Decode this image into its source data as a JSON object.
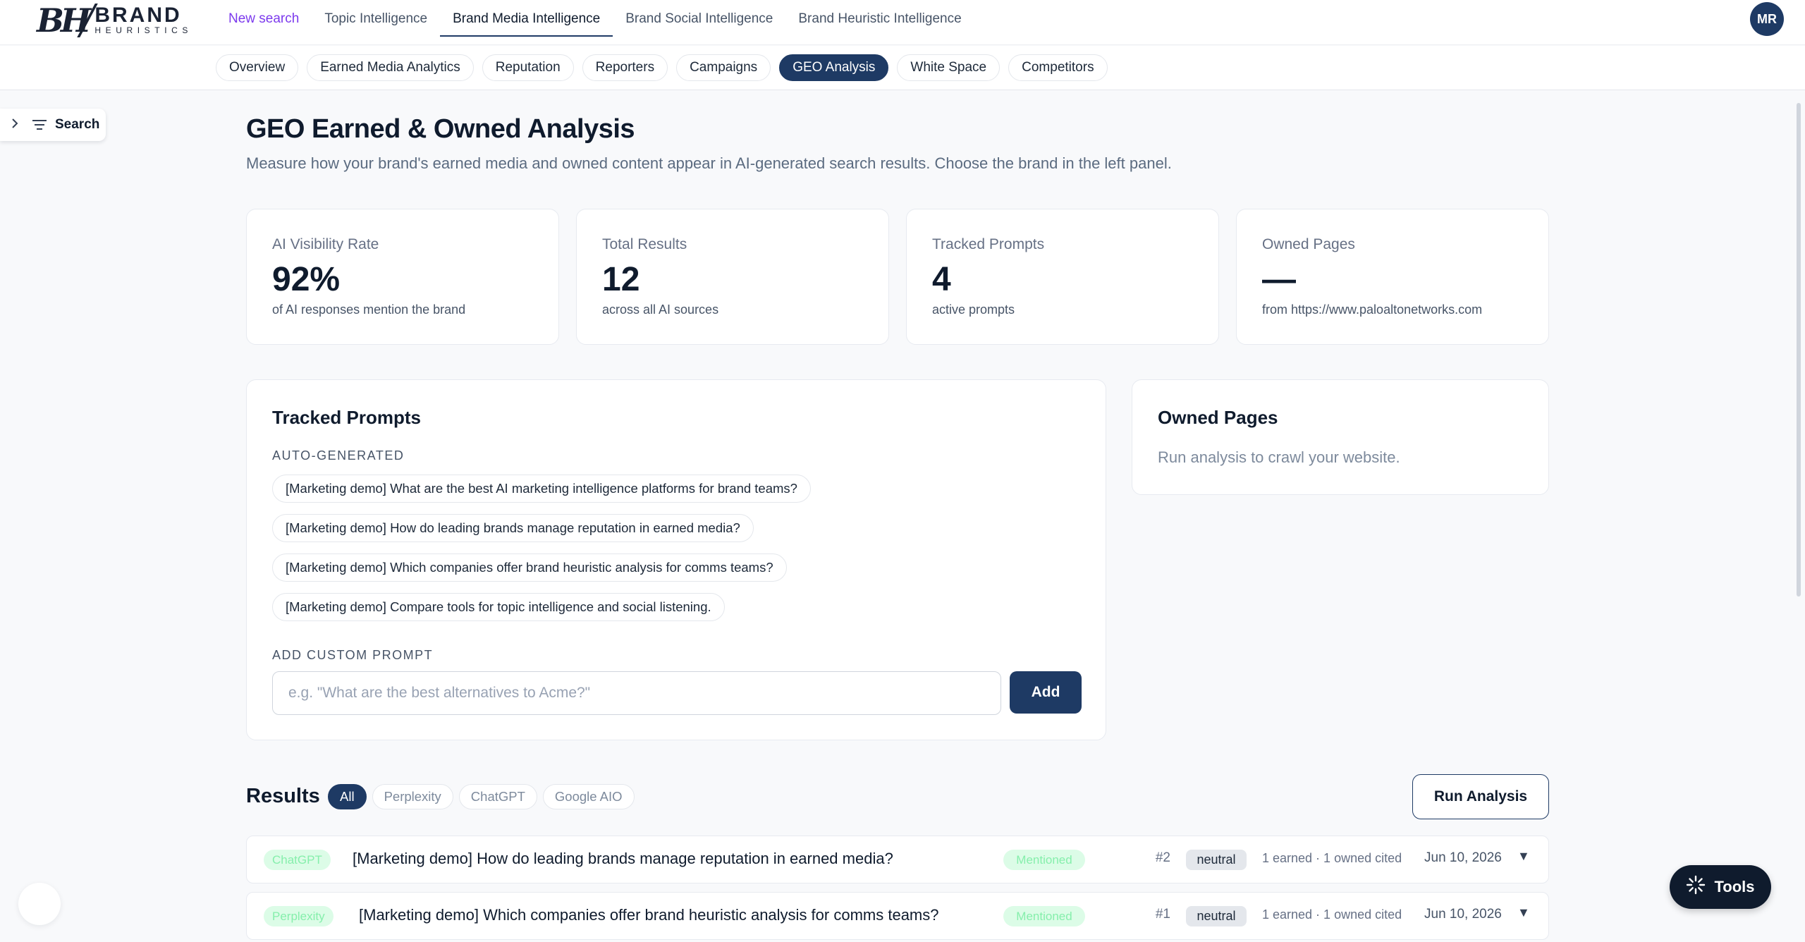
{
  "brand": {
    "mark": "BH",
    "name": "BRAND",
    "tagline": "HEURISTICS"
  },
  "topnav": {
    "items": [
      {
        "label": "New search"
      },
      {
        "label": "Topic Intelligence"
      },
      {
        "label": "Brand Media Intelligence"
      },
      {
        "label": "Brand Social Intelligence"
      },
      {
        "label": "Brand Heuristic Intelligence"
      }
    ],
    "active": "Brand Media Intelligence"
  },
  "user": {
    "initials": "MR"
  },
  "subnav": {
    "items": [
      {
        "label": "Overview"
      },
      {
        "label": "Earned Media Analytics"
      },
      {
        "label": "Reputation"
      },
      {
        "label": "Reporters"
      },
      {
        "label": "Campaigns"
      },
      {
        "label": "GEO Analysis"
      },
      {
        "label": "White Space"
      },
      {
        "label": "Competitors"
      }
    ],
    "active": "GEO Analysis"
  },
  "side_search": {
    "label": "Search"
  },
  "page": {
    "title": "GEO Earned & Owned Analysis",
    "subtitle": "Measure how your brand's earned media and owned content appear in AI-generated search results. Choose the brand in the left panel."
  },
  "stats": [
    {
      "label": "AI Visibility Rate",
      "value": "92%",
      "note": "of AI responses mention the brand"
    },
    {
      "label": "Total Results",
      "value": "12",
      "note": "across all AI sources"
    },
    {
      "label": "Tracked Prompts",
      "value": "4",
      "note": "active prompts"
    },
    {
      "label": "Owned Pages",
      "value": "—",
      "note": "from https://www.paloaltonetworks.com"
    }
  ],
  "tracked_prompts": {
    "title": "Tracked Prompts",
    "auto_label": "AUTO-GENERATED",
    "prompts": [
      "[Marketing demo] What are the best AI marketing intelligence platforms for brand teams?",
      "[Marketing demo] How do leading brands manage reputation in earned media?",
      "[Marketing demo] Which companies offer brand heuristic analysis for comms teams?",
      "[Marketing demo] Compare tools for topic intelligence and social listening."
    ],
    "custom_label": "ADD CUSTOM PROMPT",
    "custom_placeholder": "e.g. \"What are the best alternatives to Acme?\"",
    "add_label": "Add"
  },
  "owned_pages": {
    "title": "Owned Pages",
    "empty_text": "Run analysis to crawl your website."
  },
  "results": {
    "title": "Results",
    "filters": [
      "All",
      "Perplexity",
      "ChatGPT",
      "Google AIO"
    ],
    "active_filter": "All",
    "run_label": "Run Analysis",
    "rows": [
      {
        "source": "ChatGPT",
        "question": "[Marketing demo] How do leading brands manage reputation in earned media?",
        "status": "Mentioned",
        "rank": "#2",
        "sentiment": "neutral",
        "cited": "1 earned · 1 owned cited",
        "date": "Jun 10, 2026",
        "caret": "▼"
      },
      {
        "source": "Perplexity",
        "question": "[Marketing demo] Which companies offer brand heuristic analysis for comms teams?",
        "status": "Mentioned",
        "rank": "#1",
        "sentiment": "neutral",
        "cited": "1 earned · 1 owned cited",
        "date": "Jun 10, 2026",
        "caret": "▼"
      }
    ]
  },
  "tools": {
    "label": "Tools"
  },
  "colors": {
    "primary": "#1e3a64",
    "accent_purple": "#7c3aed",
    "success_bg": "#dcfce7",
    "success_text": "#86efac"
  }
}
